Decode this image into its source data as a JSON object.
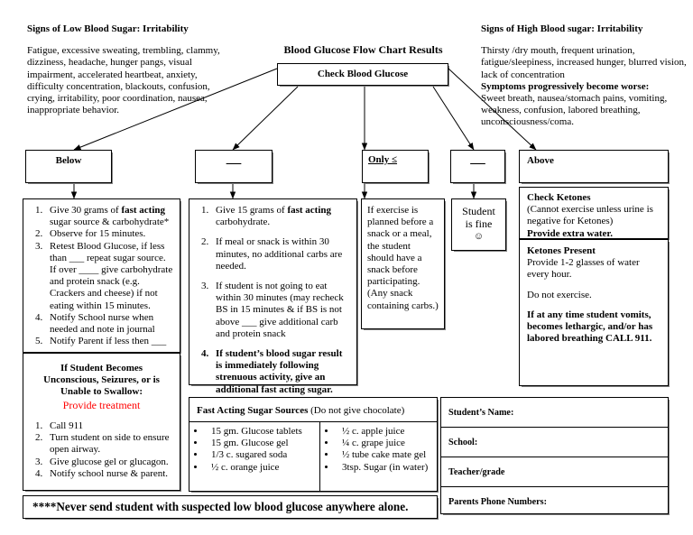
{
  "title": "Blood Glucose Flow Chart Results",
  "low_sugar_panel": {
    "heading": "Signs of Low Blood Sugar: Irritability",
    "body": "Fatigue, excessive sweating, trembling, clammy, dizziness, headache, hunger pangs, visual impairment, accelerated heartbeat, anxiety, difficulty concentration, blackouts, confusion, crying, irritability, poor coordination, nausea, inappropriate behavior."
  },
  "high_sugar_panel": {
    "heading": "Signs of High Blood sugar: Irritability",
    "body": "Thirsty /dry mouth, frequent urination, fatigue/sleepiness, increased hunger, blurred vision, lack of concentration",
    "worse_heading": "Symptoms progressively become worse:",
    "worse_body": "Sweet breath, nausea/stomach pains, vomiting, weakness, confusion, labored breathing, unconsciousness/coma."
  },
  "root_node": {
    "label": "Check Blood Glucose"
  },
  "condition_boxes": [
    {
      "name": "below",
      "label": "Below"
    },
    {
      "name": "blank-range-1",
      "label": "___"
    },
    {
      "name": "only-less-than",
      "label": "Only ≤"
    },
    {
      "name": "blank-range-2",
      "label": "___"
    },
    {
      "name": "above",
      "label": "Above"
    }
  ],
  "below_actions": {
    "items": [
      {
        "pre": "Give 30 grams of ",
        "bold": "fast acting",
        "post": " sugar source & carbohydrate*"
      },
      {
        "pre": "Observe for 15 minutes.",
        "bold": "",
        "post": ""
      },
      {
        "pre": "Retest Blood Glucose, if less than ___ repeat sugar source. If over ____ give carbohydrate and protein snack (e.g. Crackers and cheese) if not eating within 15 minutes.",
        "bold": "",
        "post": ""
      },
      {
        "pre": "Notify School nurse when needed and note in journal",
        "bold": "",
        "post": ""
      },
      {
        "pre": "Notify Parent if less then ___",
        "bold": "",
        "post": ""
      }
    ]
  },
  "emergency": {
    "heading_line1": "If Student Becomes",
    "heading_line2": "Unconscious, Seizures, or is",
    "heading_line3": "Unable to Swallow:",
    "heading_line4": "Provide treatment",
    "heading_line4_color": "#ff0000",
    "items": [
      "Call 911",
      "Turn student on side to ensure open airway.",
      "Give glucose gel or glucagon.",
      "Notify school nurse & parent."
    ]
  },
  "mid_actions": {
    "items": [
      {
        "pre": "Give 15 grams of ",
        "bold": "fast acting",
        "post": " carbohydrate.",
        "is_bold_item": false
      },
      {
        "pre": "If meal or snack is within 30 minutes, no additional carbs are needed.",
        "bold": "",
        "post": "",
        "is_bold_item": false
      },
      {
        "pre": "If student is not going to eat within 30 minutes (may recheck BS in 15 minutes & if BS is not above ___ give additional carb and protein snack",
        "bold": "",
        "post": "",
        "is_bold_item": false
      },
      {
        "pre": "If student’s blood sugar result is immediately following strenuous activity, give an additional fast acting sugar.",
        "bold": "",
        "post": "",
        "is_bold_item": true
      }
    ]
  },
  "exercise_note": {
    "text": "If exercise is planned before a snack or a meal, the student should have a snack before participating. (Any snack containing carbs.)"
  },
  "student_fine": {
    "line1": "Student",
    "line2": "is fine",
    "emoji": "☺"
  },
  "ketones": {
    "check_heading": "Check Ketones",
    "check_body": "(Cannot exercise unless urine is negative for Ketones)",
    "check_bold_line": "Provide extra water.",
    "present_heading": "Ketones Present",
    "present_body": "Provide 1-2 glasses of water every hour.",
    "no_exercise": "Do not exercise.",
    "warning": "If at any time student vomits, becomes lethargic, and/or has labored breathing CALL 911."
  },
  "sugar_sources": {
    "heading_bold": "Fast Acting Sugar Sources",
    "heading_rest": " (Do not give chocolate)",
    "col_left": [
      "15 gm. Glucose tablets",
      "15 gm. Glucose gel",
      "1/3 c. sugared soda",
      "½ c. orange juice"
    ],
    "col_right": [
      "½ c. apple juice",
      "¼ c. grape juice",
      "½ tube cake mate gel",
      "3tsp. Sugar (in water)"
    ]
  },
  "student_form": {
    "rows": [
      {
        "label": "Student’s Name:"
      },
      {
        "label": "School:"
      },
      {
        "label": "Teacher/grade"
      },
      {
        "label": "Parents Phone Numbers:"
      }
    ]
  },
  "footer_warning": {
    "text": "****Never send student with suspected low blood glucose anywhere alone."
  }
}
